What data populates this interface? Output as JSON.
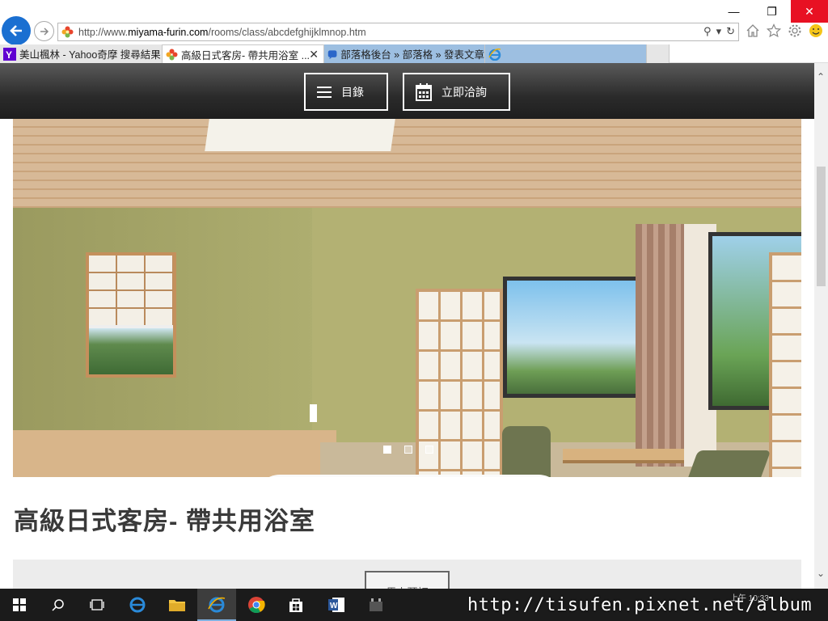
{
  "browser": {
    "url_prefix": "http://www.",
    "url_domain": "miyama-furin.com",
    "url_path": "/rooms/class/abcdefghijklmnop.htm",
    "tabs": [
      {
        "label": "美山楓林 - Yahoo奇摩 搜尋結果",
        "icon": "yahoo-icon"
      },
      {
        "label": "高級日式客房- 帶共用浴室 ...",
        "icon": "flower-favicon",
        "active": true
      },
      {
        "label": "部落格後台 » 部落格 » 發表文章",
        "icon": "blog-icon"
      },
      {
        "label": "",
        "icon": "ie-icon"
      }
    ]
  },
  "header": {
    "menu_label": "目錄",
    "enquire_label": "立即洽詢"
  },
  "main": {
    "room_title": "高級日式客房- 帶共用浴室",
    "slider_dots": 3,
    "book_label": "馬上預訂"
  },
  "taskbar": {
    "time": "上午 10:33"
  },
  "watermark": "http://tisufen.pixnet.net/album",
  "colors": {
    "header_bg": "#2b2b2b",
    "close_red": "#e81123",
    "back_blue": "#1a6fd1",
    "tab_blue": "#9dbfe1"
  }
}
